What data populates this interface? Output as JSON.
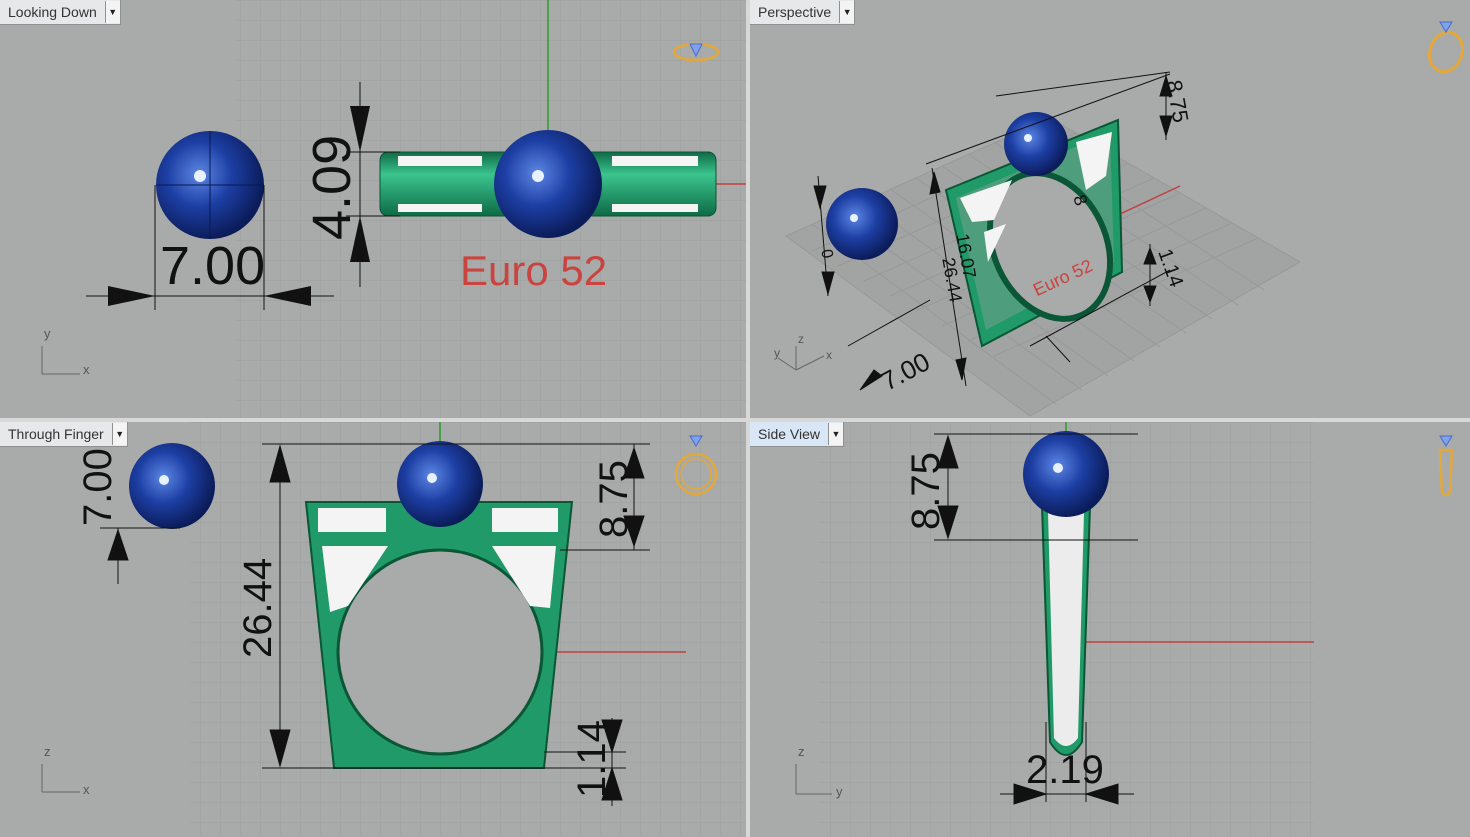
{
  "viewports": {
    "top": {
      "title": "Looking Down",
      "axis_v": "y",
      "axis_h": "x",
      "dims": {
        "width": "7.00",
        "height": "4.09"
      },
      "size_label": "Euro 52"
    },
    "persp": {
      "title": "Perspective",
      "axis_v": "y",
      "axis_h": "x",
      "axis_z": "z",
      "dims": {
        "top": "8.75",
        "sphere": "7.00",
        "bottom": "1.14",
        "height": "26.44",
        "inner": "16.07",
        "small1": "8",
        "small2": "0"
      },
      "size_label": "Euro 52"
    },
    "front": {
      "title": "Through Finger",
      "axis_v": "z",
      "axis_h": "x",
      "dims": {
        "sphere": "7.00",
        "top": "8.75",
        "height": "26.44",
        "bottom": "1.14"
      }
    },
    "side": {
      "title": "Side View",
      "axis_v": "z",
      "axis_h": "y",
      "dims": {
        "top": "8.75",
        "width": "2.19"
      }
    }
  },
  "colors": {
    "background": "#a9abab",
    "grid": "#9c9e9e",
    "ring": "#1f9a68",
    "gem": "#1b3f9f",
    "size_text": "#c9443e",
    "nav_icon": "#e4a838"
  }
}
